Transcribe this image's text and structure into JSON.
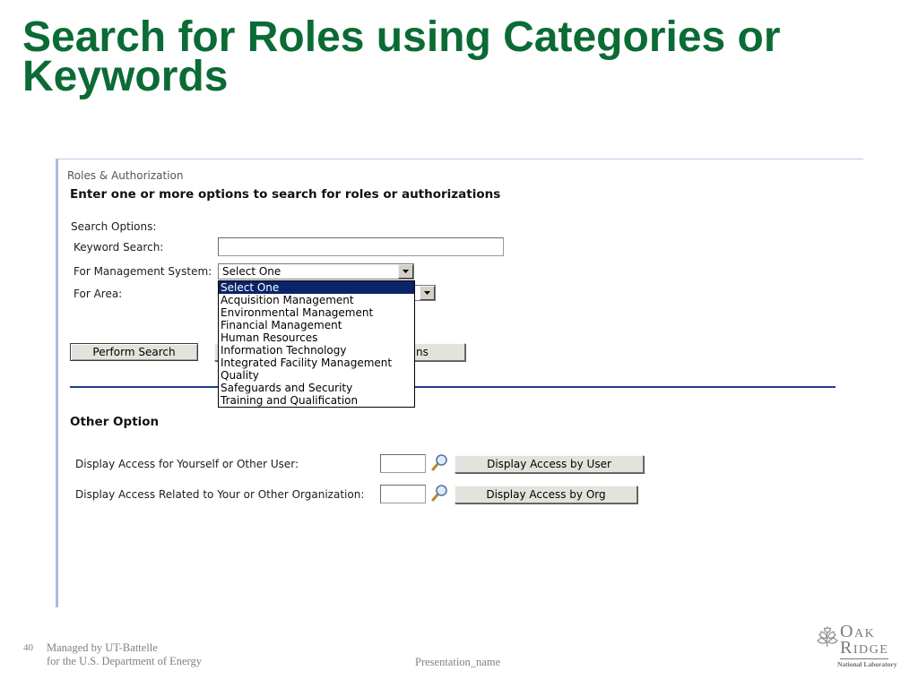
{
  "slide": {
    "title": {
      "line1": "Search for Roles using Categories or",
      "line2": "Keywords"
    },
    "footer": {
      "page_number": "40",
      "managed_by": "Managed by UT-Battelle",
      "department": "for the U.S. Department of Energy",
      "presentation_name": "Presentation_name"
    },
    "logo": {
      "line1": "OAK",
      "line2": "RIDGE",
      "line3": "National Laboratory",
      "icon": "leaf-icon"
    }
  },
  "app": {
    "breadcrumb": "Roles & Authorization",
    "heading": "Enter one or more options to search for roles or authorizations",
    "search_options": {
      "label": "Search Options:",
      "keyword": {
        "label": "Keyword Search:",
        "value": ""
      },
      "management_system": {
        "label": "For Management System:",
        "selected": "Select One",
        "expanded": true,
        "highlighted_index": 0,
        "options": [
          "Select One",
          "Acquisition Management",
          "Environmental Management",
          "Financial Management",
          "Human Resources",
          "Information Technology",
          "Integrated Facility Management",
          "Quality",
          "Safeguards and Security",
          "Training and Qualification"
        ]
      },
      "area": {
        "label": "For Area:",
        "selected": ""
      },
      "perform_search_button": "Perform Search",
      "obscured_button_visible_text": "ns"
    },
    "other_option": {
      "heading": "Other Option",
      "user": {
        "label": "Display Access for Yourself or Other User:",
        "value": "",
        "lookup_icon": "magnifier-icon",
        "button": "Display Access by User"
      },
      "org": {
        "label": "Display Access Related to Your or Other Organization:",
        "value": "",
        "lookup_icon": "magnifier-icon",
        "button": "Display Access by Org"
      }
    }
  },
  "icons": {
    "dropdown_arrow": "triangle-down-icon",
    "lookup": "magnifier-icon",
    "logo": "leaf-icon"
  },
  "colors": {
    "title": "#0b6b35",
    "panel_border": "#a6bcdc",
    "separator": "#1f3d8c",
    "selection_bg": "#0a246a",
    "button_bg": "#e4e2dd",
    "footer_text": "#808080",
    "logo": "#7a7a7a"
  }
}
